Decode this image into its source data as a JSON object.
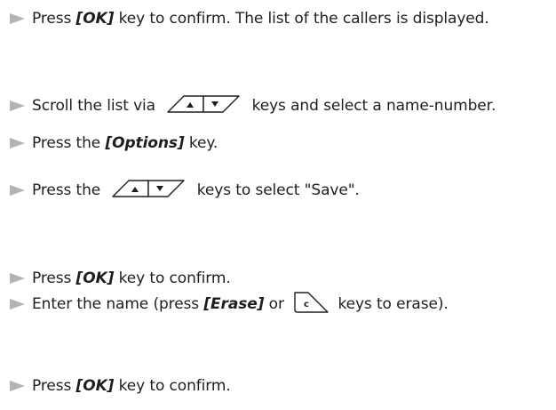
{
  "steps": [
    {
      "pre": "Press ",
      "key": "[OK]",
      "post": " key to confirm. The list of the callers is displayed."
    },
    {
      "pre": "Scroll the list via ",
      "post": " keys and select a name-number."
    },
    {
      "pre": "Press the ",
      "key": "[Options]",
      "post": " key."
    },
    {
      "pre": "Press the ",
      "post": " keys to select \"Save\"."
    },
    {
      "pre": "Press ",
      "key": "[OK]",
      "post": " key to confirm."
    },
    {
      "pre": "Enter the name (press ",
      "key": "[Erase]",
      "mid": " or ",
      "post": " keys to erase)."
    },
    {
      "pre": "Press ",
      "key": "[OK]",
      "post": " key to confirm."
    }
  ],
  "icons": {
    "up": "up-arrow-key-icon",
    "down": "down-arrow-key-icon",
    "clear": "c-clear-key-icon",
    "bullet": "triangle-bullet-icon"
  },
  "clear_key_letter": "c",
  "colors": {
    "text": "#1e1e1e",
    "bullet": "#b3b3b3",
    "key_outline": "#1e1e1e"
  }
}
